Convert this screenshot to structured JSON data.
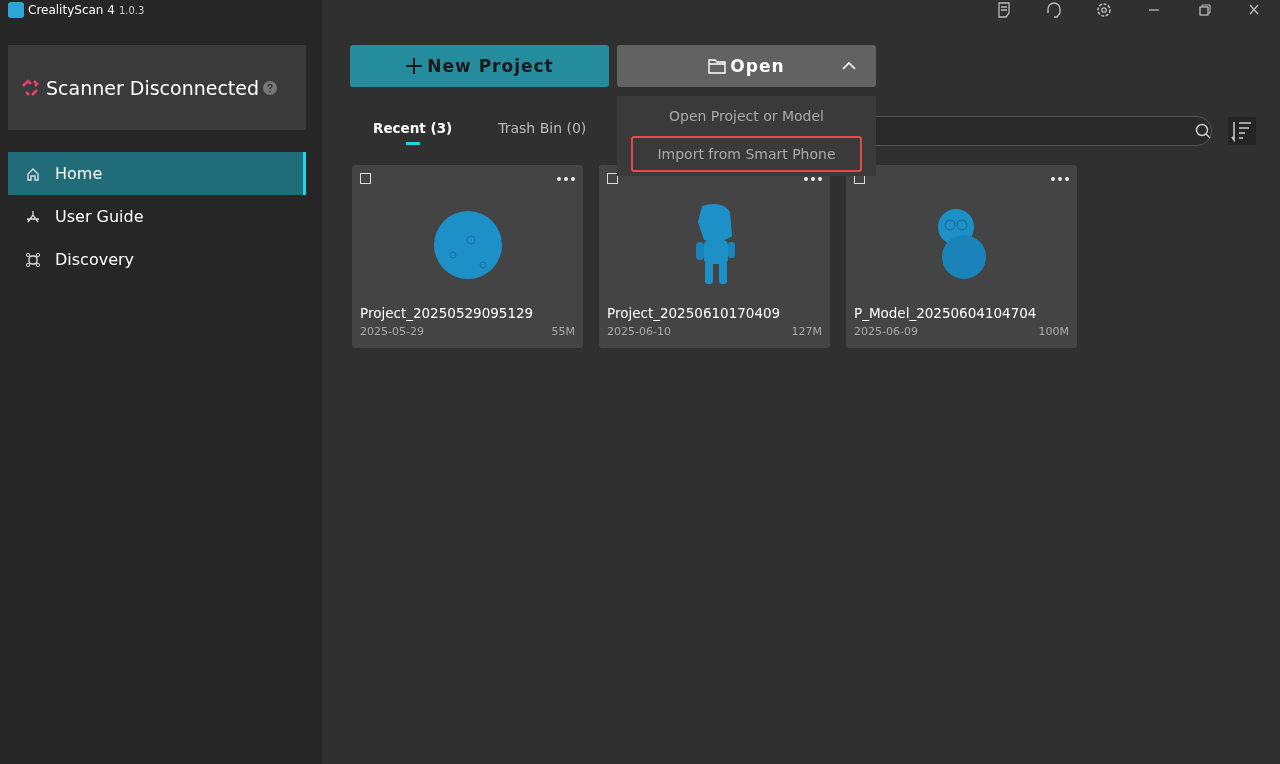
{
  "app": {
    "name": "CrealityScan 4",
    "version": "1.0.3"
  },
  "scanner": {
    "status": "Scanner Disconnected",
    "connected": false
  },
  "nav": [
    {
      "label": "Home",
      "kind": "home",
      "selected": true
    },
    {
      "label": "User Guide",
      "kind": "guide",
      "selected": false
    },
    {
      "label": "Discovery",
      "kind": "discovery",
      "selected": false
    }
  ],
  "actions": {
    "new_project": "New Project",
    "open": "Open",
    "open_expanded": true
  },
  "open_menu": [
    {
      "label": "Open Project or Model",
      "highlighted": false
    },
    {
      "label": "Import from Smart Phone",
      "highlighted": true
    }
  ],
  "tabs": [
    {
      "label": "Recent (3)",
      "selected": true
    },
    {
      "label": "Trash Bin (0)",
      "selected": false
    }
  ],
  "projects": [
    {
      "name": "Project_20250529095129",
      "date": "2025-05-29",
      "size": "55M",
      "checked": false,
      "kind": "sphere"
    },
    {
      "name": "Project_20250610170409",
      "date": "2025-06-10",
      "size": "127M",
      "checked": false,
      "kind": "figure"
    },
    {
      "name": "P_Model_20250604104704",
      "date": "2025-06-09",
      "size": "100M",
      "checked": false,
      "kind": "owl"
    }
  ]
}
